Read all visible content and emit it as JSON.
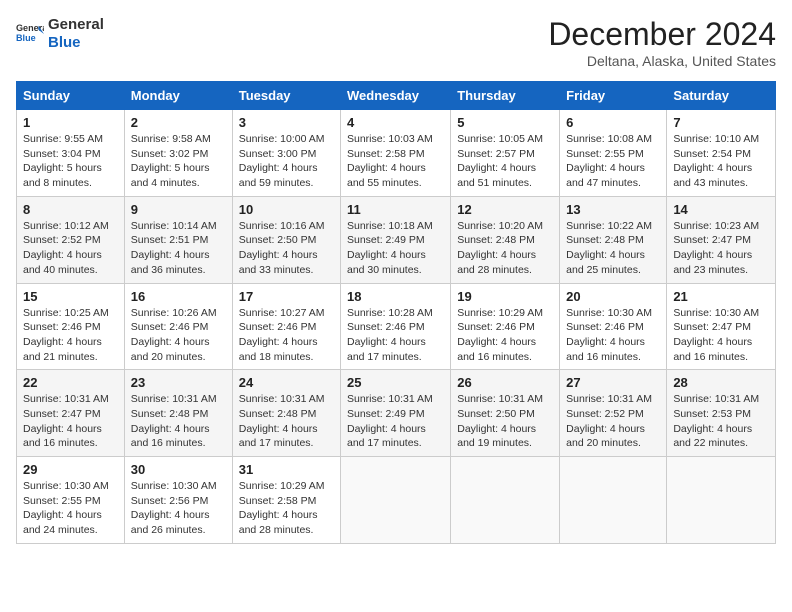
{
  "header": {
    "logo_general": "General",
    "logo_blue": "Blue",
    "title": "December 2024",
    "subtitle": "Deltana, Alaska, United States"
  },
  "weekdays": [
    "Sunday",
    "Monday",
    "Tuesday",
    "Wednesday",
    "Thursday",
    "Friday",
    "Saturday"
  ],
  "weeks": [
    [
      {
        "day": "1",
        "sunrise": "9:55 AM",
        "sunset": "3:04 PM",
        "daylight": "5 hours and 8 minutes."
      },
      {
        "day": "2",
        "sunrise": "9:58 AM",
        "sunset": "3:02 PM",
        "daylight": "5 hours and 4 minutes."
      },
      {
        "day": "3",
        "sunrise": "10:00 AM",
        "sunset": "3:00 PM",
        "daylight": "4 hours and 59 minutes."
      },
      {
        "day": "4",
        "sunrise": "10:03 AM",
        "sunset": "2:58 PM",
        "daylight": "4 hours and 55 minutes."
      },
      {
        "day": "5",
        "sunrise": "10:05 AM",
        "sunset": "2:57 PM",
        "daylight": "4 hours and 51 minutes."
      },
      {
        "day": "6",
        "sunrise": "10:08 AM",
        "sunset": "2:55 PM",
        "daylight": "4 hours and 47 minutes."
      },
      {
        "day": "7",
        "sunrise": "10:10 AM",
        "sunset": "2:54 PM",
        "daylight": "4 hours and 43 minutes."
      }
    ],
    [
      {
        "day": "8",
        "sunrise": "10:12 AM",
        "sunset": "2:52 PM",
        "daylight": "4 hours and 40 minutes."
      },
      {
        "day": "9",
        "sunrise": "10:14 AM",
        "sunset": "2:51 PM",
        "daylight": "4 hours and 36 minutes."
      },
      {
        "day": "10",
        "sunrise": "10:16 AM",
        "sunset": "2:50 PM",
        "daylight": "4 hours and 33 minutes."
      },
      {
        "day": "11",
        "sunrise": "10:18 AM",
        "sunset": "2:49 PM",
        "daylight": "4 hours and 30 minutes."
      },
      {
        "day": "12",
        "sunrise": "10:20 AM",
        "sunset": "2:48 PM",
        "daylight": "4 hours and 28 minutes."
      },
      {
        "day": "13",
        "sunrise": "10:22 AM",
        "sunset": "2:48 PM",
        "daylight": "4 hours and 25 minutes."
      },
      {
        "day": "14",
        "sunrise": "10:23 AM",
        "sunset": "2:47 PM",
        "daylight": "4 hours and 23 minutes."
      }
    ],
    [
      {
        "day": "15",
        "sunrise": "10:25 AM",
        "sunset": "2:46 PM",
        "daylight": "4 hours and 21 minutes."
      },
      {
        "day": "16",
        "sunrise": "10:26 AM",
        "sunset": "2:46 PM",
        "daylight": "4 hours and 20 minutes."
      },
      {
        "day": "17",
        "sunrise": "10:27 AM",
        "sunset": "2:46 PM",
        "daylight": "4 hours and 18 minutes."
      },
      {
        "day": "18",
        "sunrise": "10:28 AM",
        "sunset": "2:46 PM",
        "daylight": "4 hours and 17 minutes."
      },
      {
        "day": "19",
        "sunrise": "10:29 AM",
        "sunset": "2:46 PM",
        "daylight": "4 hours and 16 minutes."
      },
      {
        "day": "20",
        "sunrise": "10:30 AM",
        "sunset": "2:46 PM",
        "daylight": "4 hours and 16 minutes."
      },
      {
        "day": "21",
        "sunrise": "10:30 AM",
        "sunset": "2:47 PM",
        "daylight": "4 hours and 16 minutes."
      }
    ],
    [
      {
        "day": "22",
        "sunrise": "10:31 AM",
        "sunset": "2:47 PM",
        "daylight": "4 hours and 16 minutes."
      },
      {
        "day": "23",
        "sunrise": "10:31 AM",
        "sunset": "2:48 PM",
        "daylight": "4 hours and 16 minutes."
      },
      {
        "day": "24",
        "sunrise": "10:31 AM",
        "sunset": "2:48 PM",
        "daylight": "4 hours and 17 minutes."
      },
      {
        "day": "25",
        "sunrise": "10:31 AM",
        "sunset": "2:49 PM",
        "daylight": "4 hours and 17 minutes."
      },
      {
        "day": "26",
        "sunrise": "10:31 AM",
        "sunset": "2:50 PM",
        "daylight": "4 hours and 19 minutes."
      },
      {
        "day": "27",
        "sunrise": "10:31 AM",
        "sunset": "2:52 PM",
        "daylight": "4 hours and 20 minutes."
      },
      {
        "day": "28",
        "sunrise": "10:31 AM",
        "sunset": "2:53 PM",
        "daylight": "4 hours and 22 minutes."
      }
    ],
    [
      {
        "day": "29",
        "sunrise": "10:30 AM",
        "sunset": "2:55 PM",
        "daylight": "4 hours and 24 minutes."
      },
      {
        "day": "30",
        "sunrise": "10:30 AM",
        "sunset": "2:56 PM",
        "daylight": "4 hours and 26 minutes."
      },
      {
        "day": "31",
        "sunrise": "10:29 AM",
        "sunset": "2:58 PM",
        "daylight": "4 hours and 28 minutes."
      },
      null,
      null,
      null,
      null
    ]
  ],
  "labels": {
    "sunrise": "Sunrise:",
    "sunset": "Sunset:",
    "daylight": "Daylight:"
  }
}
